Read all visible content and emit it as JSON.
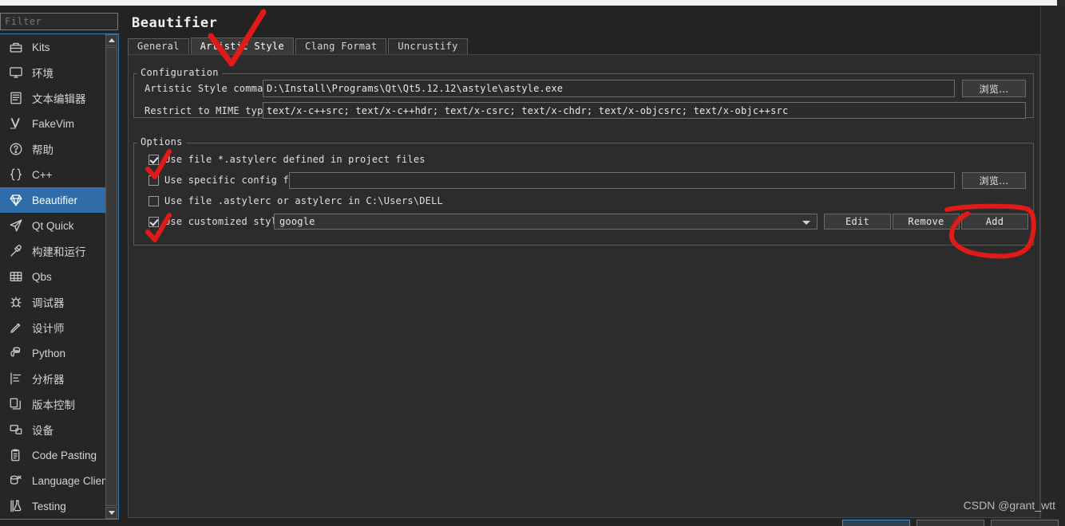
{
  "window": {
    "title": "Beautifier"
  },
  "sidebar": {
    "filter": {
      "placeholder": "Filter",
      "value": ""
    },
    "items": [
      {
        "label": "Kits",
        "icon": "kits-icon",
        "selected": false
      },
      {
        "label": "环境",
        "icon": "environment-icon",
        "selected": false
      },
      {
        "label": "文本编辑器",
        "icon": "text-editor-icon",
        "selected": false
      },
      {
        "label": "FakeVim",
        "icon": "fakevim-icon",
        "selected": false
      },
      {
        "label": "帮助",
        "icon": "help-icon",
        "selected": false
      },
      {
        "label": "C++",
        "icon": "cpp-icon",
        "selected": false
      },
      {
        "label": "Beautifier",
        "icon": "beautifier-diamond-icon",
        "selected": true
      },
      {
        "label": "Qt Quick",
        "icon": "qt-quick-icon",
        "selected": false
      },
      {
        "label": "构建和运行",
        "icon": "build-run-icon",
        "selected": false
      },
      {
        "label": "Qbs",
        "icon": "qbs-icon",
        "selected": false
      },
      {
        "label": "调试器",
        "icon": "debugger-icon",
        "selected": false
      },
      {
        "label": "设计师",
        "icon": "designer-icon",
        "selected": false
      },
      {
        "label": "Python",
        "icon": "python-icon",
        "selected": false
      },
      {
        "label": "分析器",
        "icon": "analyzer-icon",
        "selected": false
      },
      {
        "label": "版本控制",
        "icon": "version-control-icon",
        "selected": false
      },
      {
        "label": "设备",
        "icon": "devices-icon",
        "selected": false
      },
      {
        "label": "Code Pasting",
        "icon": "code-pasting-icon",
        "selected": false
      },
      {
        "label": "Language Client",
        "icon": "language-client-icon",
        "selected": false
      },
      {
        "label": "Testing",
        "icon": "testing-icon",
        "selected": false
      }
    ]
  },
  "tabs": [
    {
      "label": "General",
      "active": false
    },
    {
      "label": "Artistic Style",
      "active": true
    },
    {
      "label": "Clang Format",
      "active": false
    },
    {
      "label": "Uncrustify",
      "active": false
    }
  ],
  "configuration": {
    "group_title": "Configuration",
    "command_label": "Artistic Style command:",
    "command_value": "D:\\Install\\Programs\\Qt\\Qt5.12.12\\astyle\\astyle.exe",
    "command_browse_label": "浏览...",
    "mime_label": "Restrict to MIME types:",
    "mime_value": "text/x-c++src; text/x-c++hdr; text/x-csrc; text/x-chdr; text/x-objcsrc; text/x-objc++src"
  },
  "options": {
    "group_title": "Options",
    "use_project_astylerc": {
      "label": "Use file *.astylerc defined in project files",
      "checked": true
    },
    "use_specific_config": {
      "label": "Use specific config file:",
      "checked": false,
      "value": "",
      "browse_label": "浏览..."
    },
    "use_home_astylerc": {
      "label": "Use file .astylerc or astylerc in C:\\Users\\DELL",
      "checked": false
    },
    "use_customized_style": {
      "label": "Use customized style:",
      "checked": true,
      "selected_style": "google",
      "edit_label": "Edit",
      "remove_label": "Remove",
      "add_label": "Add"
    }
  },
  "annotations": {
    "color": "#e01b17",
    "marks": [
      {
        "name": "check-artistic-style-tab",
        "shape": "checkmark"
      },
      {
        "name": "check-use-project-astylerc",
        "shape": "checkmark"
      },
      {
        "name": "check-use-customized-style",
        "shape": "checkmark"
      },
      {
        "name": "circle-add-button",
        "shape": "loop"
      }
    ]
  },
  "watermark": {
    "text": "CSDN @grant_wtt"
  },
  "colors": {
    "background": "#232323",
    "panel": "#2c2c2c",
    "accent": "#2f6ca8",
    "field": "#2b2b2b",
    "text": "#e0e0e0",
    "annotation": "#e01b17"
  }
}
